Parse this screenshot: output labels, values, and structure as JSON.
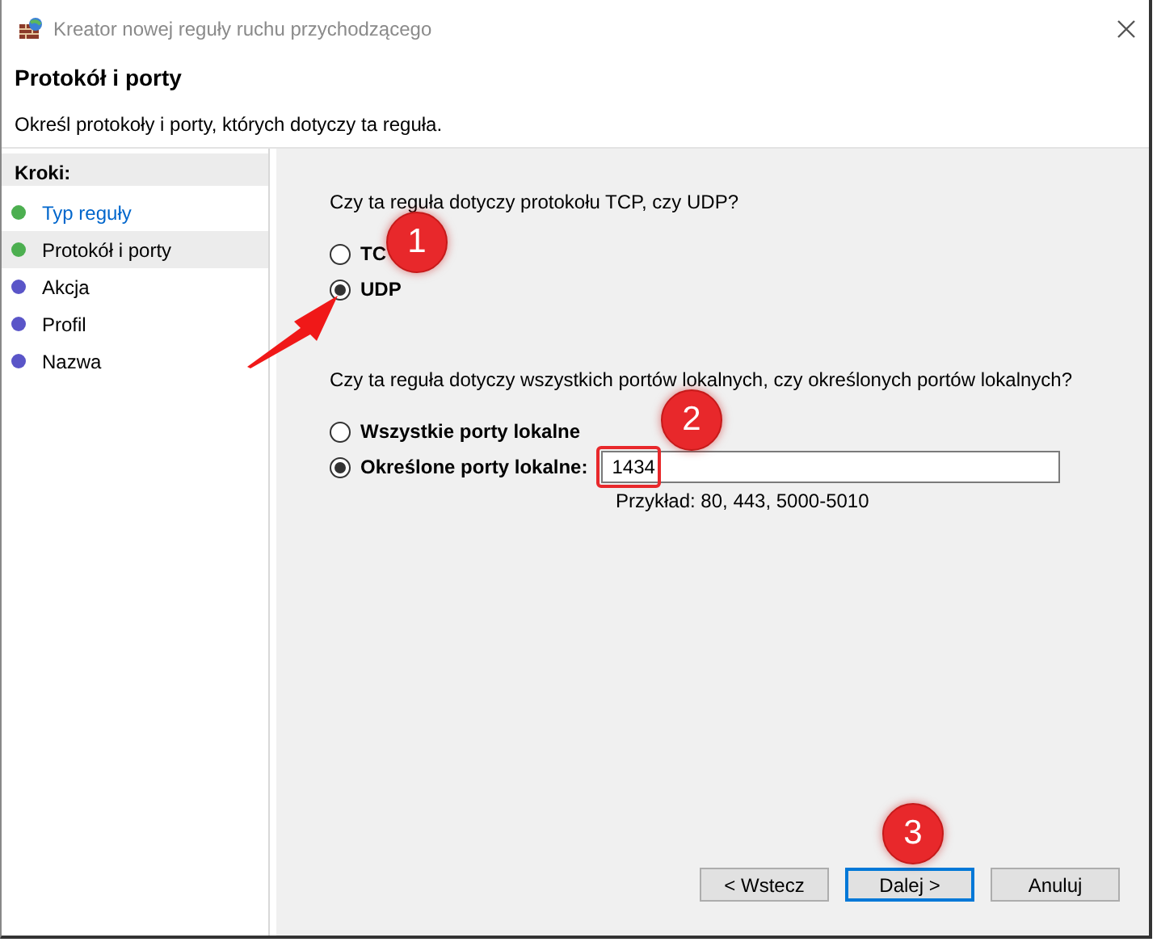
{
  "window": {
    "title": "Kreator nowej reguły ruchu przychodzącego"
  },
  "header": {
    "title": "Protokół i porty",
    "description": "Określ protokoły i porty, których dotyczy ta reguła."
  },
  "steps": {
    "heading": "Kroki:",
    "items": [
      {
        "label": "Typ reguły",
        "color": "#4caf50",
        "selected": false,
        "link": true
      },
      {
        "label": "Protokół i porty",
        "color": "#4caf50",
        "selected": true,
        "link": false
      },
      {
        "label": "Akcja",
        "color": "#5a55c8",
        "selected": false,
        "link": false
      },
      {
        "label": "Profil",
        "color": "#5a55c8",
        "selected": false,
        "link": false
      },
      {
        "label": "Nazwa",
        "color": "#5a55c8",
        "selected": false,
        "link": false
      }
    ]
  },
  "protocol": {
    "question": "Czy ta reguła dotyczy protokołu TCP, czy UDP?",
    "options": [
      {
        "label": "TC",
        "selected": false
      },
      {
        "label": "UDP",
        "selected": true
      }
    ]
  },
  "ports": {
    "question": "Czy ta reguła dotyczy wszystkich portów lokalnych, czy określonych portów lokalnych?",
    "options": [
      {
        "label": "Wszystkie porty lokalne",
        "selected": false
      },
      {
        "label": "Określone porty lokalne:",
        "selected": true
      }
    ],
    "value": "1434",
    "example": "Przykład: 80, 443, 5000-5010"
  },
  "buttons": [
    {
      "label": "< Wstecz",
      "focused": false
    },
    {
      "label": "Dalej >",
      "focused": true
    },
    {
      "label": "Anuluj",
      "focused": false
    }
  ],
  "annotations": [
    {
      "label": "1"
    },
    {
      "label": "2"
    },
    {
      "label": "3"
    }
  ]
}
